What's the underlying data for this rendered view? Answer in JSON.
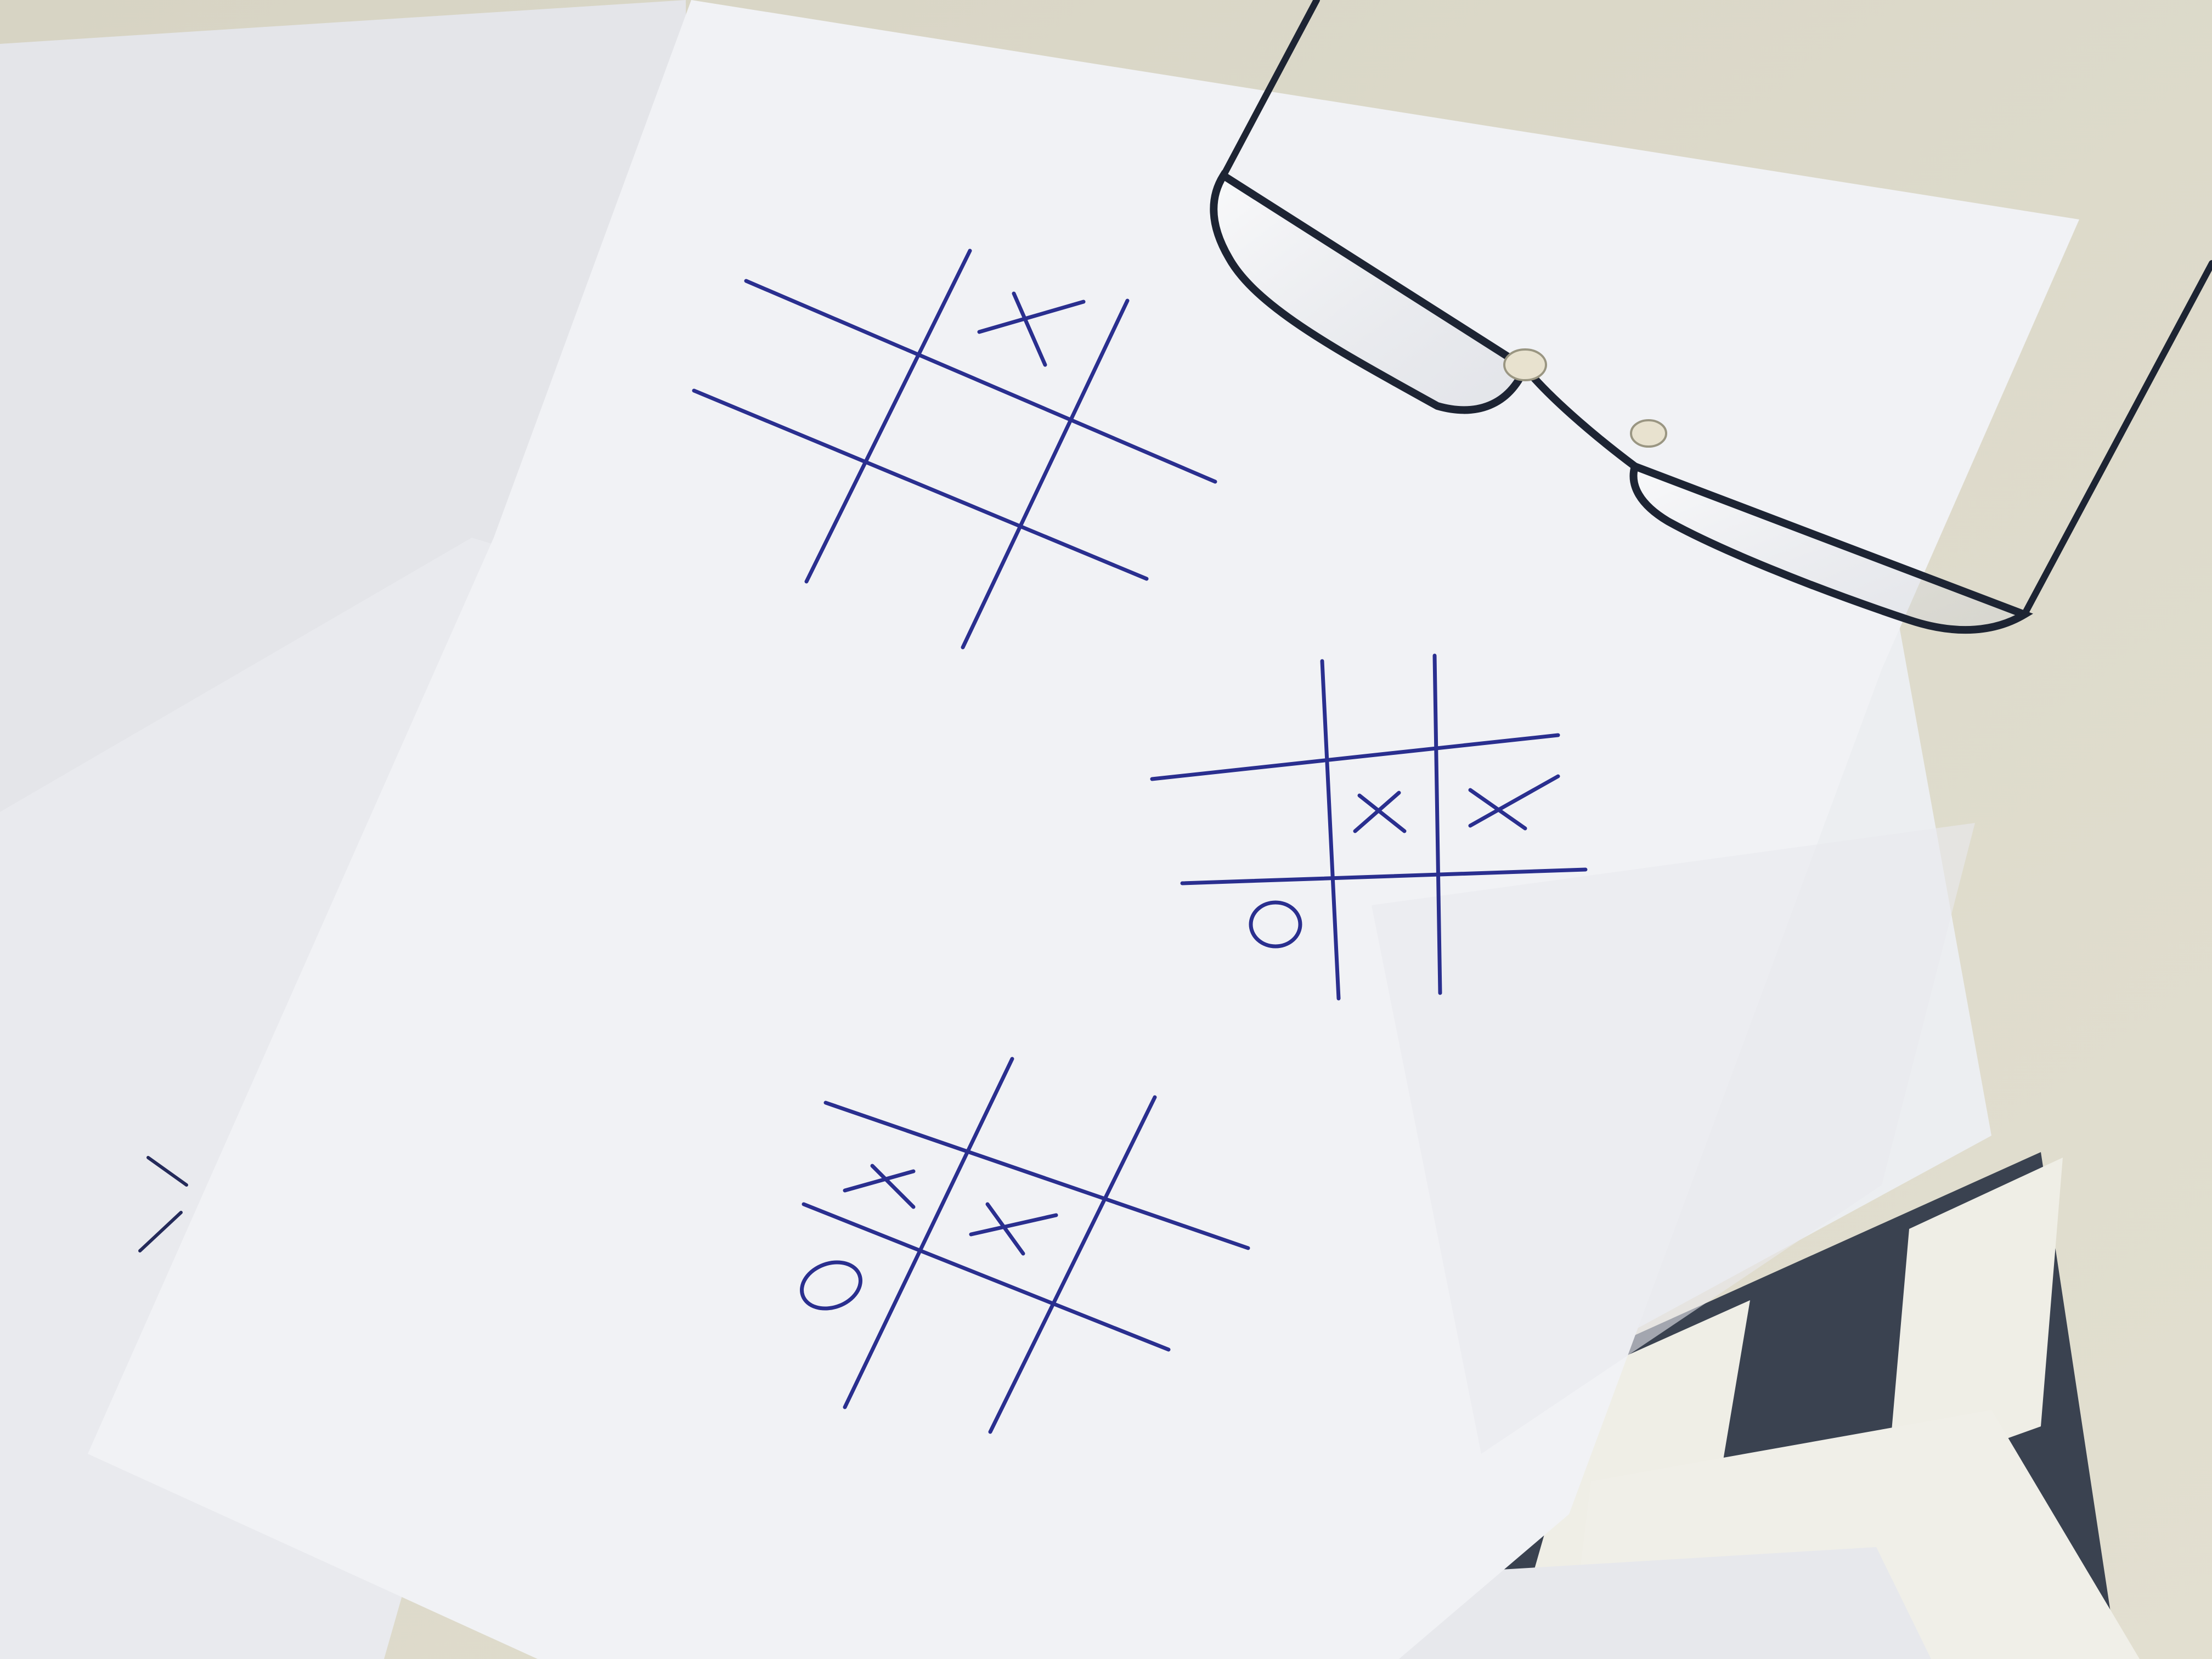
{
  "scene": {
    "description_free": true,
    "colors": {
      "table": "#d9d6c8",
      "paper_back": "#e6e7ea",
      "paper_mid": "#eceef1",
      "paper_main": "#f1f2f5",
      "ink": "#2a2f8f",
      "glasses_frame": "#1d2433",
      "clapper_dark": "#3a4250",
      "clapper_light": "#efeee6"
    }
  },
  "games": [
    {
      "name": "board-top",
      "marks": [
        {
          "cell": [
            0,
            1
          ],
          "symbol": "X"
        }
      ]
    },
    {
      "name": "board-middle",
      "marks": [
        {
          "cell": [
            1,
            1
          ],
          "symbol": "X"
        },
        {
          "cell": [
            1,
            2
          ],
          "symbol": "X"
        },
        {
          "cell": [
            2,
            0
          ],
          "symbol": "O"
        }
      ]
    },
    {
      "name": "board-bottom",
      "marks": [
        {
          "cell": [
            1,
            0
          ],
          "symbol": "X"
        },
        {
          "cell": [
            1,
            1
          ],
          "symbol": "X"
        },
        {
          "cell": [
            2,
            0
          ],
          "symbol": "O"
        }
      ]
    }
  ]
}
